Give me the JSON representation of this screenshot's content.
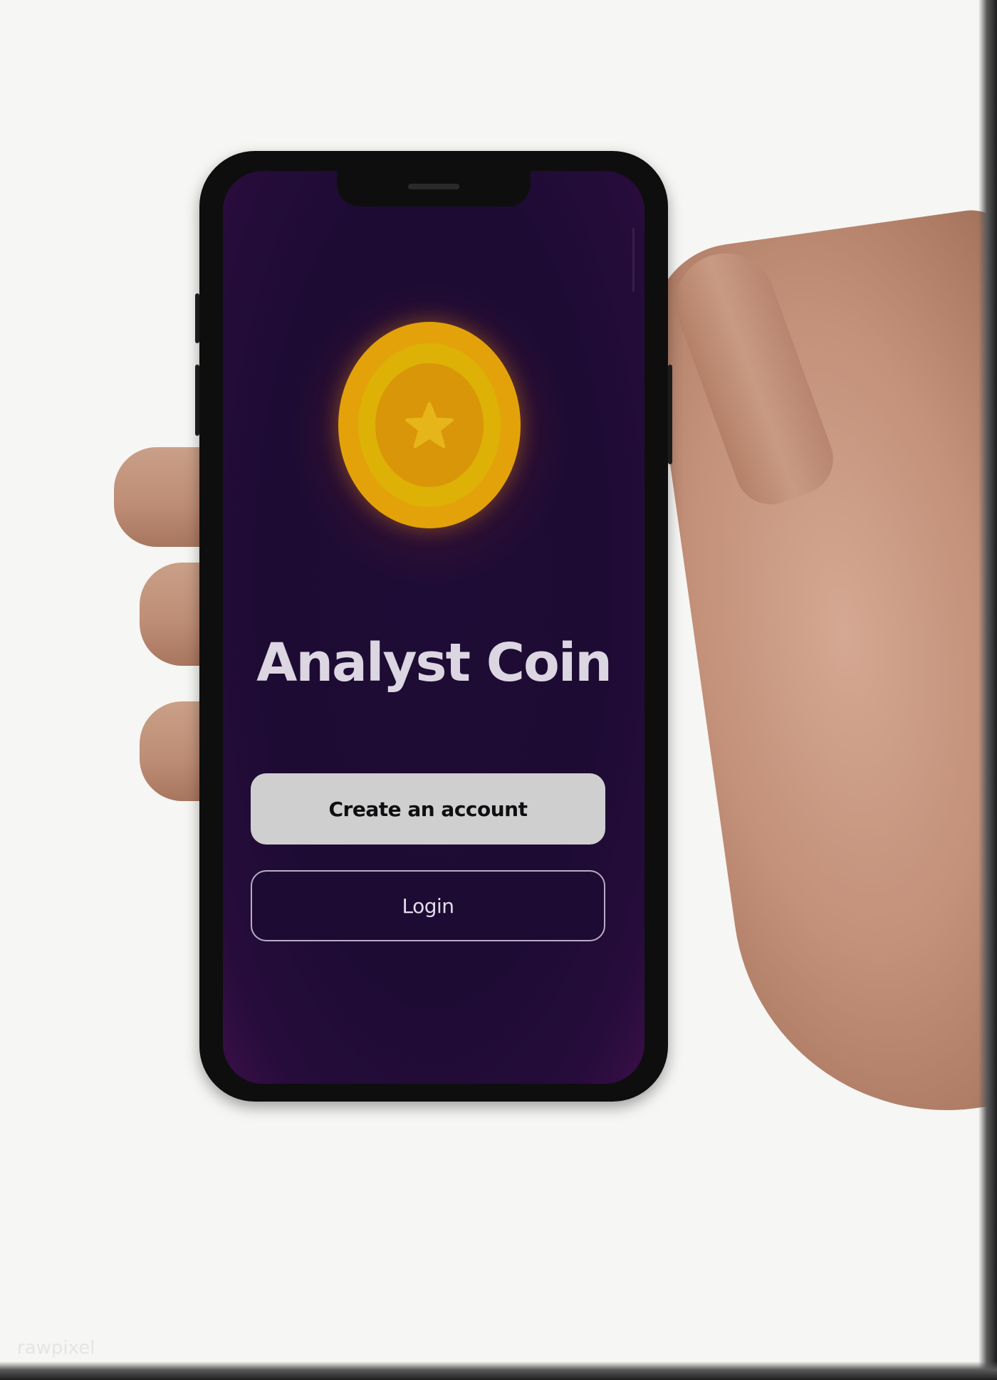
{
  "app": {
    "title": "Analyst Coin",
    "create_account_label": "Create an account",
    "login_label": "Login"
  },
  "watermark": "rawpixel",
  "icons": {
    "coin": "coin-star-icon"
  },
  "colors": {
    "screen_background": "#1d0b33",
    "coin_outer": "#e3a20a",
    "coin_ring": "#ddb106",
    "coin_center": "#d99608",
    "title_text": "#dcd6e2",
    "primary_button": "#cfcfcf",
    "secondary_button_border": "#b9adc6"
  }
}
